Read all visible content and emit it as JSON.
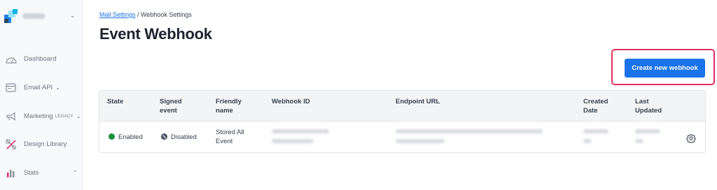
{
  "sidebar": {
    "items": [
      {
        "label": "Dashboard",
        "icon": "gauge-icon"
      },
      {
        "label": "Email API",
        "icon": "email-api-icon"
      },
      {
        "label": "Marketing",
        "badge": "LEGACY",
        "icon": "megaphone-icon"
      },
      {
        "label": "Design Library",
        "icon": "design-library-icon"
      },
      {
        "label": "Stats",
        "icon": "bar-chart-icon"
      }
    ]
  },
  "breadcrumb": {
    "parent": "Mail Settings",
    "separator": " / ",
    "current": "Webhook Settings"
  },
  "page": {
    "title": "Event Webhook"
  },
  "actions": {
    "create_label": "Create new webhook"
  },
  "table": {
    "headers": [
      "State",
      "Signed event",
      "Friendly name",
      "Webhook ID",
      "Endpoint URL",
      "Created Date",
      "Last Updated"
    ],
    "rows": [
      {
        "state": "Enabled",
        "state_color": "#1e8e3e",
        "signed": "Disabled",
        "signed_color": "#4b5563",
        "friendly_name": "Stored All Event"
      }
    ]
  },
  "colors": {
    "accent": "#1a73e8",
    "highlight": "#e0315f"
  }
}
